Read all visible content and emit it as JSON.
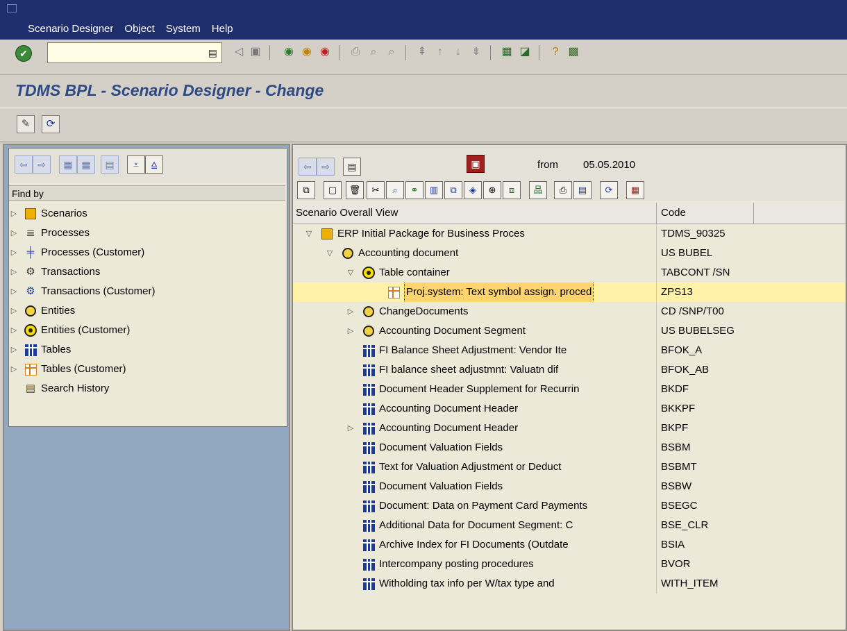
{
  "menubar": {
    "items": [
      "Scenario Designer",
      "Object",
      "System",
      "Help"
    ]
  },
  "title": "TDMS BPL - Scenario Designer - Change",
  "left": {
    "find_by": "Find by",
    "tree": [
      {
        "label": "Scenarios",
        "icon": "scenario-icon"
      },
      {
        "label": "Processes",
        "icon": "process-icon"
      },
      {
        "label": "Processes (Customer)",
        "icon": "process-customer-icon"
      },
      {
        "label": "Transactions",
        "icon": "transaction-icon"
      },
      {
        "label": "Transactions (Customer)",
        "icon": "transaction-customer-icon"
      },
      {
        "label": "Entities",
        "icon": "entity-icon"
      },
      {
        "label": "Entities (Customer)",
        "icon": "entity-customer-icon"
      },
      {
        "label": "Tables",
        "icon": "table-icon"
      },
      {
        "label": "Tables (Customer)",
        "icon": "table-customer-icon"
      },
      {
        "label": "Search History",
        "icon": "search-history-icon"
      }
    ]
  },
  "right": {
    "from_label": "from",
    "from_date": "05.05.2010",
    "columns": {
      "view": "Scenario Overall View",
      "code": "Code"
    },
    "rows": [
      {
        "label": "ERP Initial Package for Business Proces",
        "code": "TDMS_90325"
      },
      {
        "label": "Accounting document",
        "code": "US BUBEL"
      },
      {
        "label": "Table container",
        "code": "TABCONT /SN"
      },
      {
        "label": "Proj.system: Text symbol assign. proced",
        "code": "ZPS13"
      },
      {
        "label": "ChangeDocuments",
        "code": "CD /SNP/T00"
      },
      {
        "label": "Accounting Document Segment",
        "code": "US BUBELSEG"
      },
      {
        "label": "FI Balance Sheet Adjustment: Vendor Ite",
        "code": "BFOK_A"
      },
      {
        "label": "FI balance sheet adjustmnt: Valuatn dif",
        "code": "BFOK_AB"
      },
      {
        "label": "Document Header Supplement for Recurrin",
        "code": "BKDF"
      },
      {
        "label": "Accounting Document Header",
        "code": "BKKPF"
      },
      {
        "label": "Accounting Document Header",
        "code": "BKPF"
      },
      {
        "label": "Document Valuation Fields",
        "code": "BSBM"
      },
      {
        "label": "Text for Valuation Adjustment or Deduct",
        "code": "BSBMT"
      },
      {
        "label": "Document Valuation Fields",
        "code": "BSBW"
      },
      {
        "label": "Document: Data on Payment Card Payments",
        "code": "BSEGC"
      },
      {
        "label": "Additional Data for Document Segment: C",
        "code": "BSE_CLR"
      },
      {
        "label": "Archive Index for FI Documents (Outdate",
        "code": "BSIA"
      },
      {
        "label": "Intercompany posting procedures",
        "code": "BVOR"
      },
      {
        "label": "Witholding tax info per W/tax type and",
        "code": "WITH_ITEM"
      }
    ]
  },
  "colors": {
    "menubar": "#1f2f6e",
    "title": "#2d4a86",
    "highlight_row": "#fff2a8",
    "selected_cell": "#ffd36e"
  }
}
